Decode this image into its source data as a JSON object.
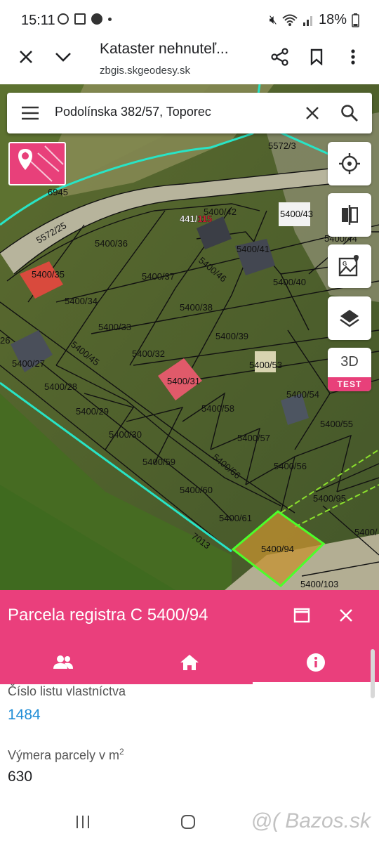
{
  "status": {
    "time": "15:11",
    "battery": "18%"
  },
  "browser": {
    "title": "Kataster nehnuteľ...",
    "url": "zbgis.skgeodesy.sk"
  },
  "search": {
    "query": "Podolínska 382/57, Toporec"
  },
  "map": {
    "building_label_main": "441/",
    "building_label_accent": "115",
    "parcels": [
      "5400/36",
      "5400/35",
      "5400/34",
      "5400/33",
      "5400/37",
      "5400/38",
      "5400/39",
      "5400/32",
      "5400/31",
      "5400/27",
      "5400/28",
      "5400/29",
      "5400/30",
      "5400/59",
      "5400/58",
      "5400/57",
      "5400/60",
      "5400/61",
      "5400/94",
      "5400/103",
      "5400/53",
      "5400/54",
      "5400/55",
      "5400/56",
      "5400/95",
      "5400/40",
      "5400/41",
      "5400/42",
      "5400/43",
      "5400/44",
      "5400/45",
      "5400/46",
      "5400/66",
      "5572/3",
      "5572/25",
      "6945",
      "7013",
      "26"
    ],
    "tool_3d": "3D",
    "tool_test": "TEST"
  },
  "panel": {
    "title": "Parcela registra C 5400/94",
    "fields": [
      {
        "label": "Číslo listu vlastníctva",
        "value": "1484"
      },
      {
        "label": "Výmera parcely v m",
        "label_sup": "2",
        "value": "630"
      }
    ]
  },
  "watermark": "@( Bazos.sk",
  "colors": {
    "accent": "#ea3f7c",
    "link": "#1f8dd6",
    "selection": "#4cff2a"
  }
}
